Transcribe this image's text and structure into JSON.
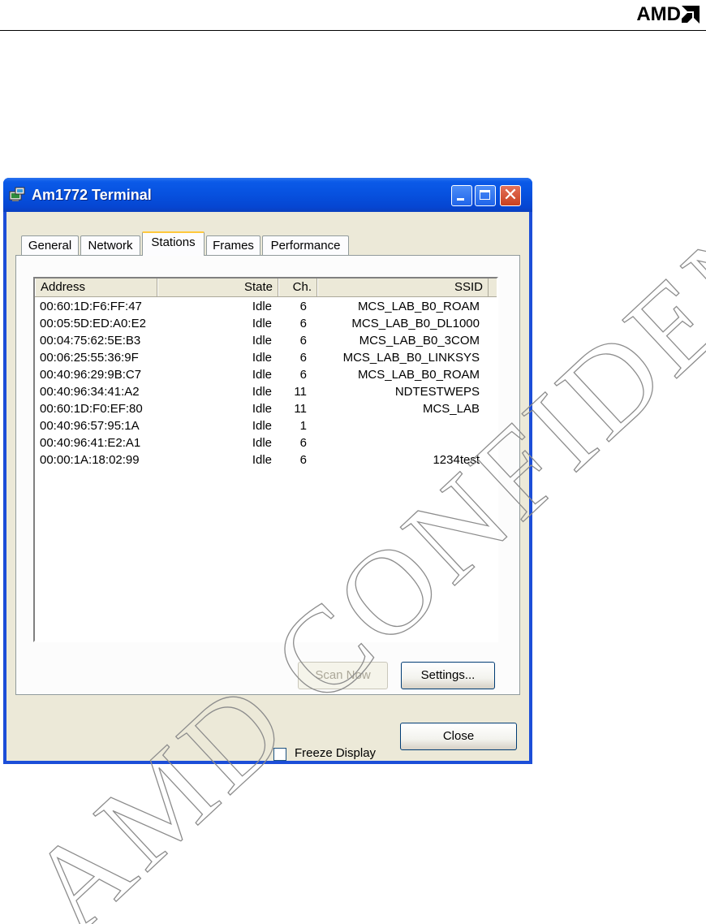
{
  "document": {
    "logo_text": "AMD",
    "watermark": "AMD CONFIDENTIAL"
  },
  "window": {
    "title": "Am1772  Terminal",
    "controls": [
      "minimize",
      "maximize",
      "close"
    ],
    "close_glyph": "✕"
  },
  "tabs": [
    {
      "label": "General",
      "active": false
    },
    {
      "label": "Network",
      "active": false
    },
    {
      "label": "Stations",
      "active": true
    },
    {
      "label": "Frames",
      "active": false
    },
    {
      "label": "Performance",
      "active": false
    }
  ],
  "stations": {
    "columns": [
      "Address",
      "State",
      "Ch.",
      "SSID"
    ],
    "rows": [
      {
        "address": "00:60:1D:F6:FF:47",
        "state": "Idle",
        "ch": "6",
        "ssid": "MCS_LAB_B0_ROAM"
      },
      {
        "address": "00:05:5D:ED:A0:E2",
        "state": "Idle",
        "ch": "6",
        "ssid": "MCS_LAB_B0_DL1000"
      },
      {
        "address": "00:04:75:62:5E:B3",
        "state": "Idle",
        "ch": "6",
        "ssid": "MCS_LAB_B0_3COM"
      },
      {
        "address": "00:06:25:55:36:9F",
        "state": "Idle",
        "ch": "6",
        "ssid": "MCS_LAB_B0_LINKSYS"
      },
      {
        "address": "00:40:96:29:9B:C7",
        "state": "Idle",
        "ch": "6",
        "ssid": "MCS_LAB_B0_ROAM"
      },
      {
        "address": "00:40:96:34:41:A2",
        "state": "Idle",
        "ch": "11",
        "ssid": "NDTESTWEPS"
      },
      {
        "address": "00:60:1D:F0:EF:80",
        "state": "Idle",
        "ch": "11",
        "ssid": "MCS_LAB"
      },
      {
        "address": "00:40:96:57:95:1A",
        "state": "Idle",
        "ch": "1",
        "ssid": ""
      },
      {
        "address": "00:40:96:41:E2:A1",
        "state": "Idle",
        "ch": "6",
        "ssid": ""
      },
      {
        "address": "00:00:1A:18:02:99",
        "state": "Idle",
        "ch": "6",
        "ssid": "1234test"
      }
    ],
    "scan_label": "Scan Now",
    "scan_enabled": false,
    "settings_label": "Settings..."
  },
  "footer": {
    "freeze_label": "Freeze Display",
    "freeze_checked": false,
    "close_label": "Close"
  },
  "colors": {
    "titlebar": "#0752e0",
    "dialog_bg": "#ece9d8",
    "tab_active_highlight": "#ffc83c"
  }
}
